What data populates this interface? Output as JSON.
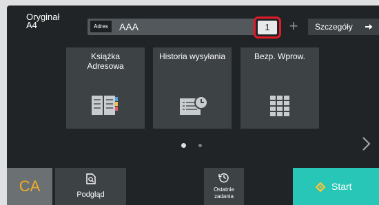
{
  "original": {
    "label": "Oryginał",
    "size": "A4"
  },
  "address": {
    "key_label": "Adres",
    "value": "AAA"
  },
  "copies": {
    "count": "1",
    "plus": "+"
  },
  "details": {
    "label": "Szczegóły"
  },
  "tiles": [
    {
      "label": "Książka\nAdresowa",
      "icon": "address-book-icon"
    },
    {
      "label": "Historia wysyłania",
      "icon": "send-history-icon"
    },
    {
      "label": "Bezp. Wprow.",
      "icon": "keypad-icon"
    }
  ],
  "pager": {
    "pages": 2,
    "current": 1
  },
  "bottom": {
    "ca": "CA",
    "preview": "Podgląd",
    "recent": "Ostatnie\nzadania",
    "start": "Start"
  },
  "colors": {
    "accent": "#27c6b6",
    "highlight": "#e21b2a",
    "ca_text": "#f0ad2a"
  }
}
